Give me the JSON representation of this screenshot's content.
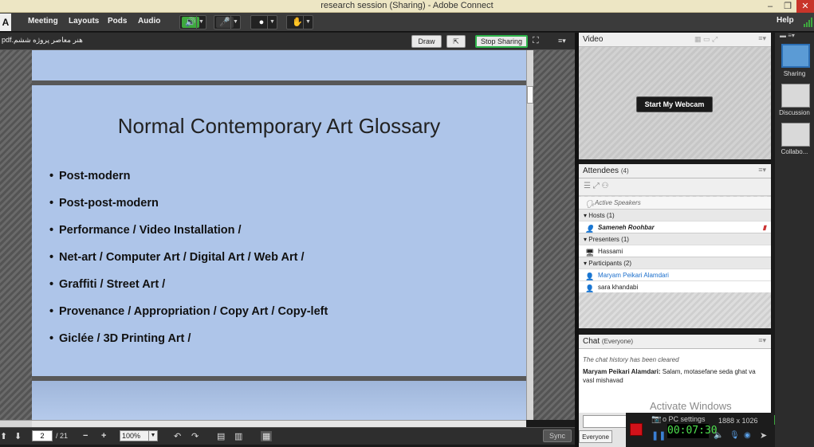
{
  "window": {
    "title": "research session (Sharing) - Adobe Connect",
    "minimize": "–",
    "maximize": "❐",
    "close": "✕"
  },
  "menu": {
    "items": [
      "Meeting",
      "Layouts",
      "Pods",
      "Audio"
    ],
    "help": "Help"
  },
  "share_pod": {
    "filename": "هنر معاصر پروژه ششم.pdf",
    "draw_label": "Draw",
    "stop_sharing_label": "Stop Sharing",
    "menu_icon": "≡▾"
  },
  "slide": {
    "title": "Normal Contemporary Art Glossary",
    "bullets": [
      "Post-modern",
      "Post-post-modern",
      "Performance / Video Installation /",
      "Net-art / Computer Art / Digital Art / Web Art /",
      "Graffiti / Street Art /",
      "Provenance / Appropriation / Copy Art / Copy-left",
      "Giclée / 3D Printing Art /"
    ]
  },
  "navigation": {
    "page": "2",
    "total": "/ 21",
    "zoom": "100%",
    "sync_label": "Sync"
  },
  "video_pod": {
    "title": "Video",
    "webcam_button": "Start My Webcam"
  },
  "attendees_pod": {
    "title": "Attendees",
    "count": "(4)",
    "active_speakers": "Active Speakers",
    "hosts": {
      "label": "Hosts (1)",
      "users": [
        "Sameneh Roohbar"
      ]
    },
    "presenters": {
      "label": "Presenters (1)",
      "users": [
        "Hassami"
      ]
    },
    "participants": {
      "label": "Participants (2)",
      "users": [
        "Maryam Peikari Alamdari",
        "sara khandabi"
      ]
    }
  },
  "chat_pod": {
    "title": "Chat",
    "scope": "(Everyone)",
    "history_notice": "The chat history has been cleared",
    "messages": [
      {
        "sender": "Maryam Peikari Alamdari:",
        "text": " Salam, motasefane seda ghat va vasl mishavad"
      }
    ],
    "target": "Everyone"
  },
  "overlay": {
    "watermark": "Activate Windows",
    "pc_settings": "o PC settings",
    "resolution": "1888 x 1026",
    "timer": "00:07:30"
  },
  "layouts": [
    {
      "label": "Sharing"
    },
    {
      "label": "Discussion"
    },
    {
      "label": "Collabo..."
    }
  ],
  "colors": {
    "slide_bg": "#aec5e9",
    "stop_sharing_border": "#2db34a",
    "rec_stop": "#d1121a",
    "participant_link": "#1a6ecc"
  }
}
